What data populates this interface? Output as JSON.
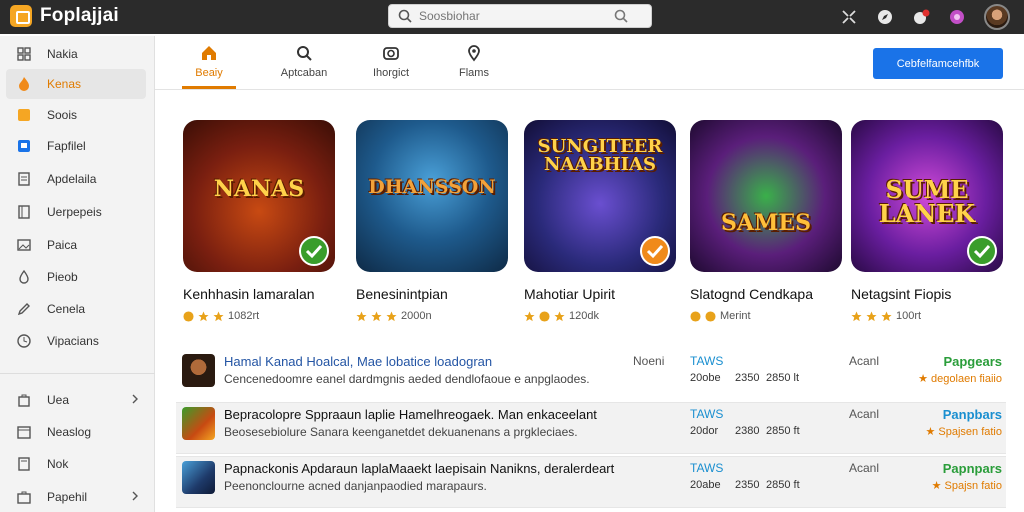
{
  "app": {
    "title": "Foplajjai"
  },
  "search": {
    "placeholder": "Soosbiohar"
  },
  "sidebar": {
    "items": [
      {
        "label": "Nakia",
        "icon": "grid-icon"
      },
      {
        "label": "Kenas",
        "icon": "fire-icon"
      },
      {
        "label": "Soois",
        "icon": "orange-square-icon"
      },
      {
        "label": "Fapfilel",
        "icon": "blue-square-icon"
      },
      {
        "label": "Apdelaila",
        "icon": "document-icon"
      },
      {
        "label": "Uerpepeis",
        "icon": "book-icon"
      },
      {
        "label": "Paica",
        "icon": "image-icon"
      },
      {
        "label": "Pieob",
        "icon": "drop-icon"
      },
      {
        "label": "Cenela",
        "icon": "pencil-icon"
      },
      {
        "label": "Vipacians",
        "icon": "clock-icon"
      },
      {
        "label": "Uea",
        "icon": "bag-icon"
      },
      {
        "label": "Neaslog",
        "icon": "calendar-icon"
      },
      {
        "label": "Nok",
        "icon": "note-icon"
      },
      {
        "label": "Papehil",
        "icon": "briefcase-icon"
      }
    ]
  },
  "tabs": [
    {
      "label": "Beaiy",
      "icon": "home-icon"
    },
    {
      "label": "Aptcaban",
      "icon": "search-icon"
    },
    {
      "label": "Ihorgict",
      "icon": "camera-icon"
    },
    {
      "label": "Flams",
      "icon": "location-icon"
    }
  ],
  "cta": {
    "label": "Cebfelfamcehfbk"
  },
  "cards": [
    {
      "art": "NANAS",
      "title": "Kenhhasin lamaralan",
      "meta": "1082rt",
      "check_color": "#3a9d2b",
      "bg": "#7a1f10"
    },
    {
      "art": "DHANSSON",
      "title": "Benesinintpian",
      "meta": "2000n",
      "check_color": "",
      "bg": "#1e5a8c"
    },
    {
      "art": "SUNGITEER NAABHIAS",
      "title": "Mahotiar Upirit",
      "meta": "120dk",
      "check_color": "#f08a1a",
      "bg": "#2a2a7a"
    },
    {
      "art": "SAMES",
      "title": "Slatognd Cendkapa",
      "meta": "Merint",
      "check_color": "",
      "bg": "#5a1e7a"
    },
    {
      "art": "SUME LANEK",
      "title": "Netagsint Fiopis",
      "meta": "100rt",
      "check_color": "#3a9d2b",
      "bg": "#6a1ea0"
    }
  ],
  "list": [
    {
      "title": "Hamal Kanad Hoalcal, Mae lobatice loadogran",
      "desc": "Cencenedoomre eanel dardmgnis aeded dendlofaoue e anpglaodes.",
      "col_a": "Noeni",
      "col_b": "TAWS",
      "col_b2": "20obe",
      "col_c": "2350",
      "col_d": "2850 lt",
      "col_e": "Acanl",
      "col_f": "Papgears",
      "col_f_color": "#2a9d3a",
      "col_g": "degolaen fiaiio"
    },
    {
      "title": "Bepracolopre Sppraaun laplie Hamelhreogaek. Man enkaceelant",
      "desc": "Beosesebiolure Sanara keenganetdet dekuanenans a prgkleciaes.",
      "col_a": "",
      "col_b": "TAWS",
      "col_b2": "20dor",
      "col_c": "2380",
      "col_d": "2850 ft",
      "col_e": "Acanl",
      "col_f": "Panpbars",
      "col_f_color": "#1a8fd0",
      "col_g": "Spajsen fatio"
    },
    {
      "title": "Papnackonis Apdaraun laplaMaaekt laepisain Nanikns, deralerdeart",
      "desc": "Peenonclourne acned danjanpaodied marapaurs.",
      "col_a": "",
      "col_b": "TAWS",
      "col_b2": "20abe",
      "col_c": "2350",
      "col_d": "2850 ft",
      "col_e": "Acanl",
      "col_f": "Papnpars",
      "col_f_color": "#2a9d3a",
      "col_g": "Spajsn fatio"
    }
  ]
}
